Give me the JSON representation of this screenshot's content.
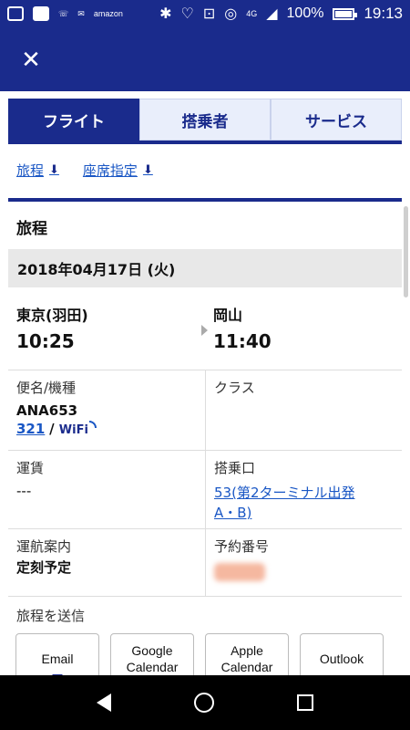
{
  "status_bar": {
    "battery": "100%",
    "time": "19:13",
    "network": "4G",
    "icons": [
      "message-icon",
      "square-icon",
      "missed-call-icon",
      "sms-icon",
      "amazon-icon",
      "bluetooth-icon",
      "heart-icon",
      "voicemail-icon",
      "nfc-icon",
      "signal-icon",
      "battery-icon"
    ]
  },
  "app_bar": {
    "close_icon": "close-icon"
  },
  "tabs": [
    {
      "label": "フライト",
      "active": true
    },
    {
      "label": "搭乗者",
      "active": false
    },
    {
      "label": "サービス",
      "active": false
    }
  ],
  "anchors": [
    {
      "label": "旅程",
      "icon": "arrow-down-icon"
    },
    {
      "label": "座席指定",
      "icon": "arrow-down-icon"
    }
  ],
  "itinerary": {
    "section_title": "旅程",
    "date": "2018年04月17日 (火)",
    "departure": {
      "city": "東京(羽田)",
      "time": "10:25"
    },
    "arrival": {
      "city": "岡山",
      "time": "11:40"
    },
    "flight_label": "便名/機種",
    "flight_number": "ANA653",
    "aircraft_link": "321",
    "wifi_label": "WiFi",
    "class_label": "クラス",
    "fare_label": "運賃",
    "fare_value": "---",
    "gate_label": "搭乗口",
    "gate_value_line1": "53(第2ターミナル出発",
    "gate_value_line2": "A・B)",
    "ops_label": "運航案内",
    "ops_value": "定刻予定",
    "booking_label": "予約番号"
  },
  "send": {
    "title": "旅程を送信",
    "buttons": [
      {
        "line1": "Email",
        "line2": ""
      },
      {
        "line1": "Google",
        "line2": "Calendar"
      },
      {
        "line1": "Apple",
        "line2": "Calendar"
      },
      {
        "line1": "Outlook",
        "line2": ""
      }
    ]
  },
  "colors": {
    "primary": "#1a2b8c",
    "link": "#1a57c5",
    "date_bg": "#e8e8e8"
  }
}
